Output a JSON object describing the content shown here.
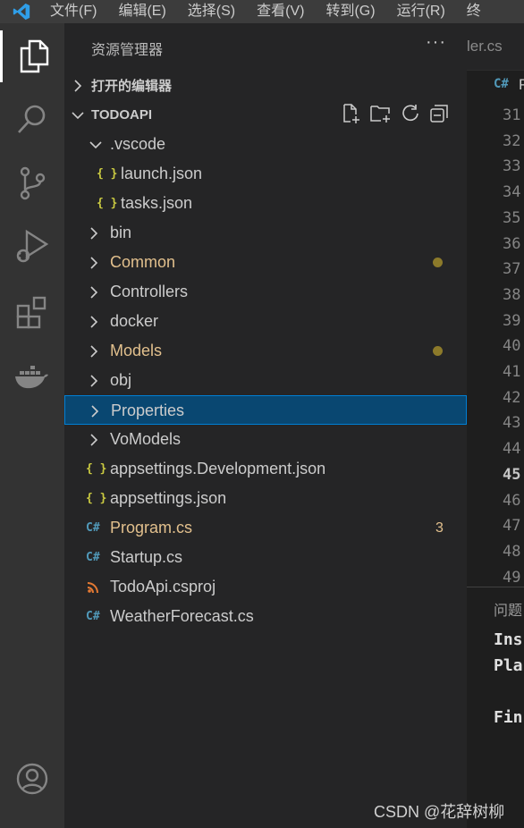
{
  "menubar": {
    "items": [
      "文件(F)",
      "编辑(E)",
      "选择(S)",
      "查看(V)",
      "转到(G)",
      "运行(R)",
      "终"
    ]
  },
  "activity_bar": {
    "icons": [
      "explorer-icon",
      "search-icon",
      "source-control-icon",
      "run-debug-icon",
      "extensions-icon",
      "docker-icon",
      "account-icon"
    ]
  },
  "sidebar": {
    "title": "资源管理器",
    "more": "···",
    "open_editors": "打开的编辑器",
    "project": "TODOAPI",
    "tree": [
      {
        "label": ".vscode",
        "type": "folder",
        "expanded": true,
        "depth": 0
      },
      {
        "label": "launch.json",
        "type": "json",
        "depth": 1
      },
      {
        "label": "tasks.json",
        "type": "json",
        "depth": 1
      },
      {
        "label": "bin",
        "type": "folder",
        "depth": 0
      },
      {
        "label": "Common",
        "type": "folder",
        "depth": 0,
        "modified": true
      },
      {
        "label": "Controllers",
        "type": "folder",
        "depth": 0
      },
      {
        "label": "docker",
        "type": "folder",
        "depth": 0
      },
      {
        "label": "Models",
        "type": "folder",
        "depth": 0,
        "modified": true
      },
      {
        "label": "obj",
        "type": "folder",
        "depth": 0
      },
      {
        "label": "Properties",
        "type": "folder",
        "depth": 0,
        "selected": true
      },
      {
        "label": "VoModels",
        "type": "folder",
        "depth": 0
      },
      {
        "label": "appsettings.Development.json",
        "type": "json",
        "depth": 0
      },
      {
        "label": "appsettings.json",
        "type": "json",
        "depth": 0
      },
      {
        "label": "Program.cs",
        "type": "cs",
        "depth": 0,
        "problems": "3"
      },
      {
        "label": "Startup.cs",
        "type": "cs",
        "depth": 0
      },
      {
        "label": "TodoApi.csproj",
        "type": "csproj",
        "depth": 0
      },
      {
        "label": "WeatherForecast.cs",
        "type": "cs",
        "depth": 0
      }
    ]
  },
  "editor": {
    "inactive_tab": "ler.cs",
    "active_tab_icon": "C#",
    "active_tab": "P",
    "line_numbers": [
      "31",
      "32",
      "33",
      "34",
      "35",
      "36",
      "37",
      "38",
      "39",
      "40",
      "41",
      "42",
      "43",
      "44",
      "45",
      "46",
      "47",
      "48",
      "49"
    ],
    "current_line": "45"
  },
  "panel": {
    "tab": "问题",
    "lines": [
      "Ins",
      "Pla",
      "",
      "Fin"
    ]
  },
  "watermark": "CSDN @花辞树柳",
  "colors": {
    "selection_bg": "#094771",
    "selection_border": "#007fd4",
    "modified_text": "#e2c08d",
    "modified_dot": "#8c7a2a",
    "json_icon": "#cbcb41",
    "cs_icon": "#519aba",
    "csproj_icon": "#e37933"
  }
}
